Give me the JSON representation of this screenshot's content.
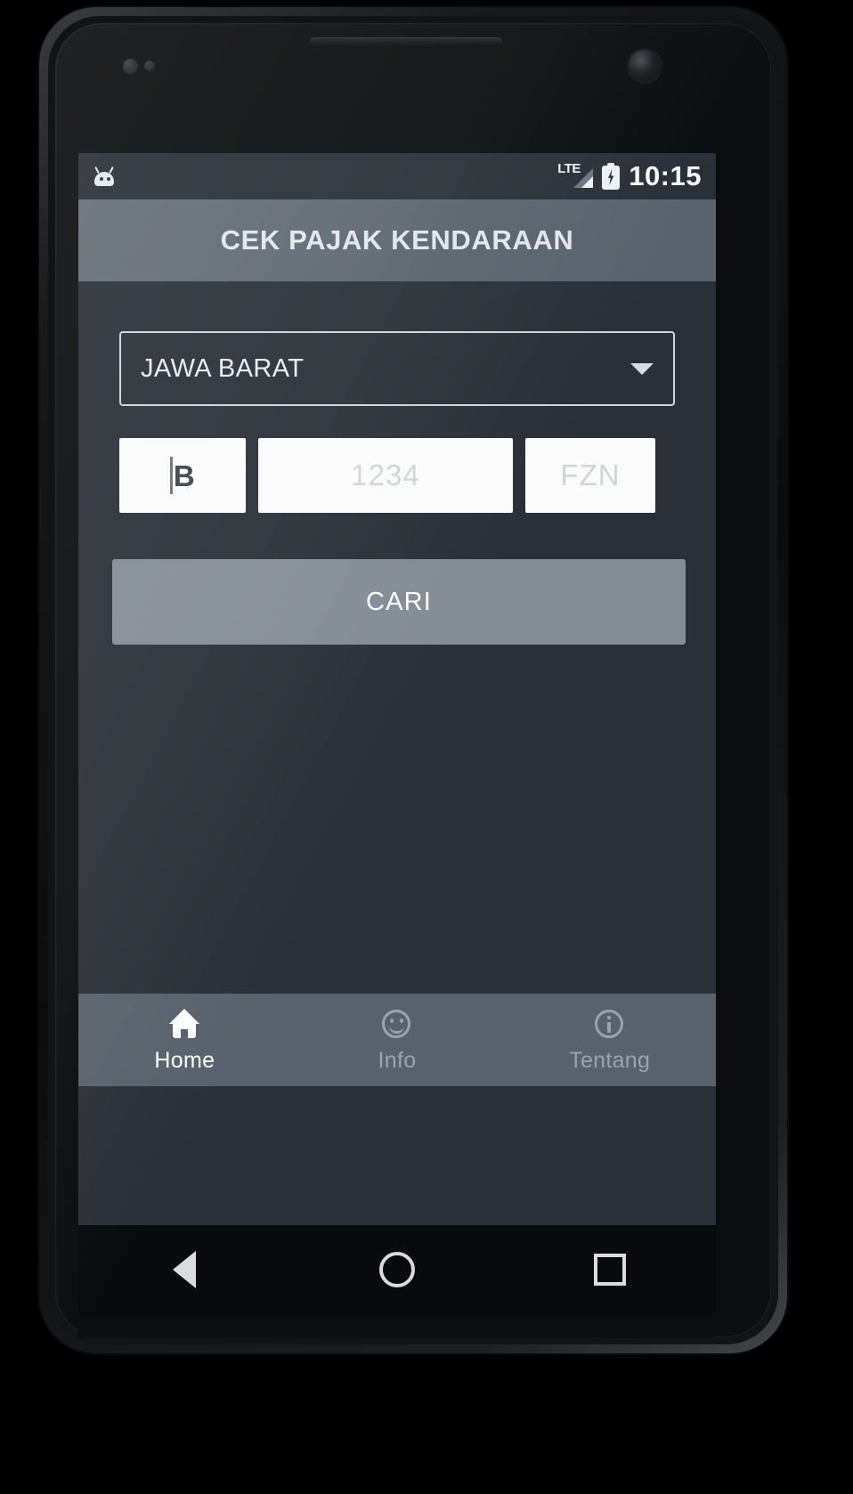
{
  "status_bar": {
    "notification_icon": "android-head-icon",
    "network_type": "LTE",
    "signal_icon": "signal-bars-icon",
    "battery_icon": "battery-charging-icon",
    "time": "10:15"
  },
  "app_bar": {
    "title": "CEK PAJAK KENDARAAN"
  },
  "form": {
    "province_spinner": {
      "value": "JAWA BARAT",
      "caret_icon": "chevron-down-icon"
    },
    "plate": {
      "prefix": {
        "value": "B",
        "placeholder": "B"
      },
      "number": {
        "value": "",
        "placeholder": "1234"
      },
      "suffix": {
        "value": "",
        "placeholder": "FZN"
      }
    },
    "submit_label": "CARI"
  },
  "tab_bar": {
    "items": [
      {
        "label": "Home",
        "icon": "home-icon",
        "active": true
      },
      {
        "label": "Info",
        "icon": "smiley-icon",
        "active": false
      },
      {
        "label": "Tentang",
        "icon": "info-circle-icon",
        "active": false
      }
    ]
  },
  "system_nav": {
    "back": "back-triangle-icon",
    "home": "home-circle-icon",
    "recents": "recents-square-icon"
  },
  "colors": {
    "screen_bg": "#2b3038",
    "app_bar": "#5a636d",
    "button": "#848c96",
    "tab_bar": "#59626c",
    "field_bg": "#fbfbfb",
    "text_light": "#e9edf1",
    "text_muted": "#9ba3ac"
  }
}
